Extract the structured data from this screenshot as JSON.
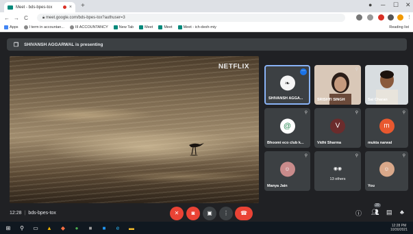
{
  "browser": {
    "tab_title": "Meet - bds-bpes-tox",
    "tab_close": "×",
    "new_tab": "+",
    "url": "meet.google.com/bds-bpes-tox?authuser=3",
    "bookmarks": [
      "Apps",
      "I term in accountan...",
      "III ACCOUNTANCY",
      "New Tab",
      "Meet",
      "Meet",
      "Meet - ich-dexh-miy"
    ],
    "reading_list": "Reading list"
  },
  "meet": {
    "presenting_text": "SHIVANSH AGGARWAL is presenting",
    "stage_watermark": "NETFLIX",
    "meeting_time": "12:28",
    "meeting_code": "bds-bpes-tox",
    "participant_count": "20",
    "tiles": [
      {
        "name": "SHIVANSH AGGA...",
        "kind": "present"
      },
      {
        "name": "SRISHTI SINGH",
        "kind": "photo"
      },
      {
        "name": "Sai Charan",
        "kind": "photo"
      },
      {
        "name": "Bhoomi eco club k...",
        "kind": "logo"
      },
      {
        "name": "Vidhi Sharma",
        "kind": "initial",
        "initial": "V",
        "color": "#6b2c2c"
      },
      {
        "name": "mukta narwal",
        "kind": "initial",
        "initial": "m",
        "color": "#e8582f"
      },
      {
        "name": "Manya Jain",
        "kind": "photo"
      },
      {
        "name": "13 others",
        "kind": "others"
      },
      {
        "name": "You",
        "kind": "photo"
      }
    ]
  },
  "taskbar": {
    "time": "12:28 PM",
    "date": "10/30/2021"
  },
  "colors": {
    "accent": "#8ab4f8",
    "red": "#ea4335",
    "meet_bg": "#202124",
    "tile_bg": "#3c4043"
  }
}
